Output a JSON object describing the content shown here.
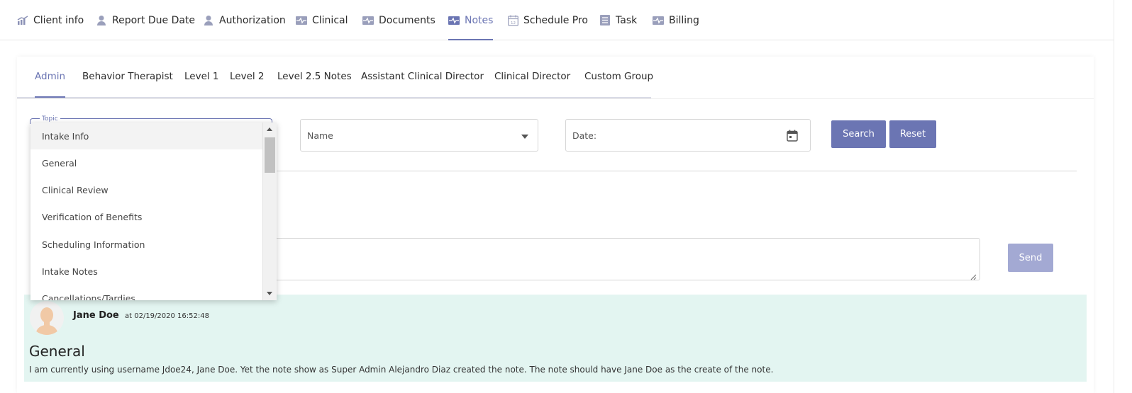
{
  "nav": {
    "items": [
      {
        "label": "Client info",
        "icon": "chart-icon"
      },
      {
        "label": "Report Due Date",
        "icon": "person-icon"
      },
      {
        "label": "Authorization",
        "icon": "person-icon"
      },
      {
        "label": "Clinical",
        "icon": "pulse-icon"
      },
      {
        "label": "Documents",
        "icon": "pulse-icon"
      },
      {
        "label": "Notes",
        "icon": "pulse-icon",
        "active": true
      },
      {
        "label": "Schedule Pro",
        "icon": "calendar-icon"
      },
      {
        "label": "Task",
        "icon": "list-icon"
      },
      {
        "label": "Billing",
        "icon": "pulse-icon"
      }
    ]
  },
  "subtabs": [
    "Admin",
    "Behavior Therapist",
    "Level 1",
    "Level 2",
    "Level 2.5 Notes",
    "Assistant Clinical Director",
    "Clinical Director",
    "Custom Group"
  ],
  "filters": {
    "topic_label": "Topic",
    "name_placeholder": "Name",
    "date_placeholder": "Date:",
    "search_label": "Search",
    "reset_label": "Reset"
  },
  "dropdown": {
    "options": [
      "Intake Info",
      "General",
      "Clinical Review",
      "Verification of Benefits",
      "Scheduling Information",
      "Intake Notes",
      "Cancellations/Tardies"
    ]
  },
  "composer": {
    "send_label": "Send"
  },
  "note": {
    "author": "Jane Doe",
    "timestamp": "at 02/19/2020 16:52:48",
    "title": "General",
    "body": "I am currently using username Jdoe24, Jane Doe. Yet the note show as Super Admin Alejandro Diaz created the note. The note should have Jane Doe as the create of the note."
  },
  "colors": {
    "accent": "#6b75b3",
    "note_bg": "#e3f5f1"
  }
}
